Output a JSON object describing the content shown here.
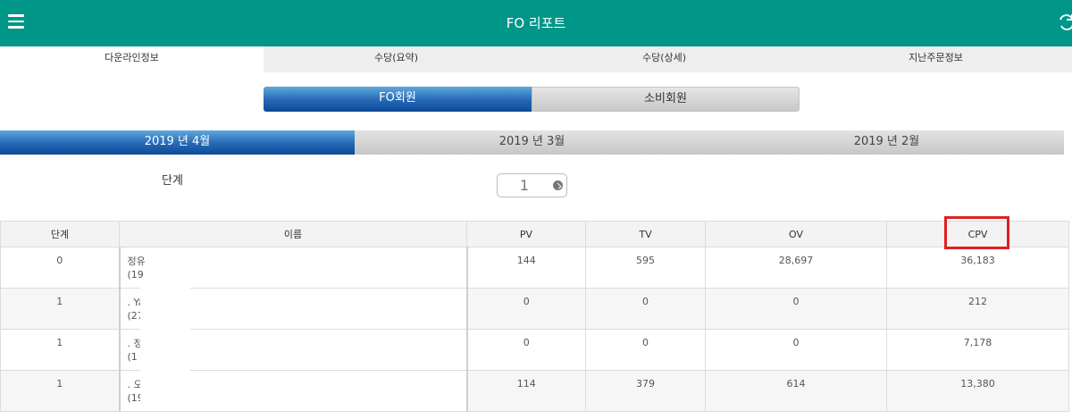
{
  "app": {
    "title": "FO 리포트"
  },
  "tabs": [
    {
      "label": "다운라인정보",
      "active": true
    },
    {
      "label": "수당(요약)",
      "active": false
    },
    {
      "label": "수당(상세)",
      "active": false
    },
    {
      "label": "지난주문정보",
      "active": false
    }
  ],
  "member_type": {
    "options": [
      "FO회원",
      "소비회원"
    ],
    "selected": "FO회원"
  },
  "months": {
    "options": [
      "2019 년 4월",
      "2019 년 3월",
      "2019 년 2월"
    ],
    "selected": "2019 년 4월"
  },
  "level_filter": {
    "label": "단계",
    "value": "1"
  },
  "table": {
    "headers": [
      "단계",
      "이름",
      "PV",
      "TV",
      "OV",
      "CPV"
    ],
    "rows": [
      {
        "level": "0",
        "name1": "정유",
        "name2": "(19",
        "pv": "144",
        "tv": "595",
        "ov": "28,697",
        "cpv": "36,183"
      },
      {
        "level": "1",
        "name1": ". Ya",
        "name2": "(27",
        "pv": "0",
        "tv": "0",
        "ov": "0",
        "cpv": "212"
      },
      {
        "level": "1",
        "name1": ". 정",
        "name2": "(1",
        "pv": "0",
        "tv": "0",
        "ov": "0",
        "cpv": "7,178"
      },
      {
        "level": "1",
        "name1": ". 오",
        "name2": "(19",
        "pv": "114",
        "tv": "379",
        "ov": "614",
        "cpv": "13,380"
      }
    ]
  },
  "colors": {
    "appbar": "#009688",
    "selected_gradient": "#2468b4",
    "highlight_box": "#e02020"
  },
  "icons": {
    "menu": "hamburger-icon",
    "refresh": "refresh-icon",
    "stepper": "chevron-circle-icon"
  }
}
